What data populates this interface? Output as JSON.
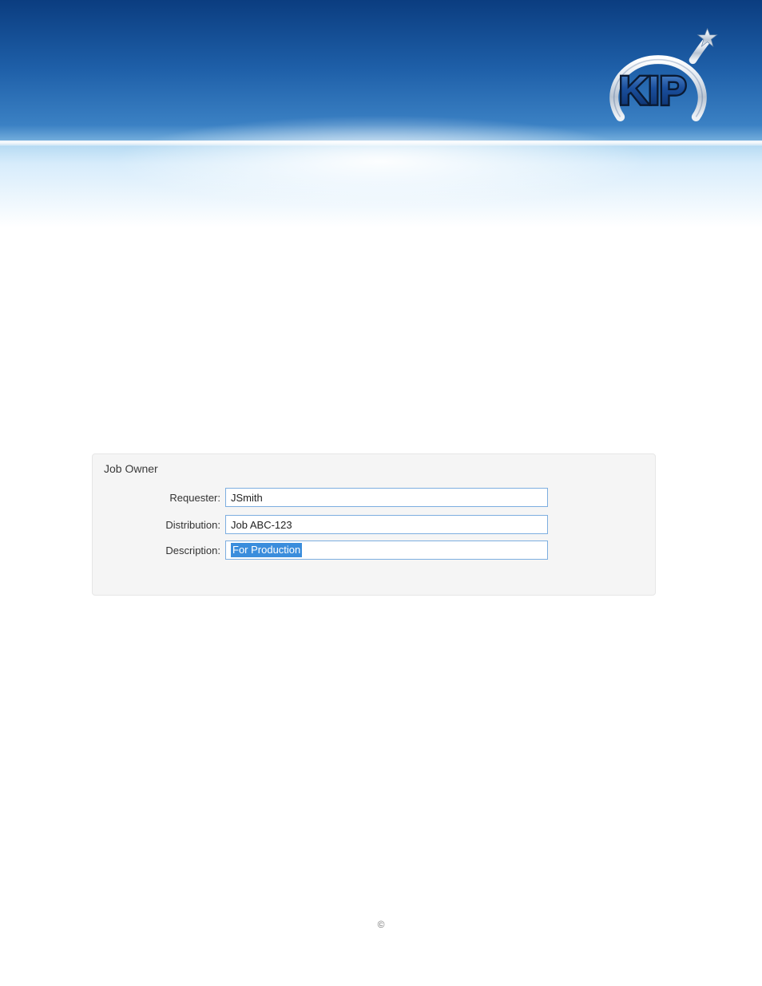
{
  "brand": {
    "name": "KIP"
  },
  "form": {
    "group_title": "Job Owner",
    "requester_label": "Requester:",
    "requester_value": "JSmith",
    "distribution_label": "Distribution:",
    "distribution_value": "Job ABC-123",
    "description_label": "Description:",
    "description_value": "For Production"
  },
  "footer": {
    "copyright": "©"
  }
}
